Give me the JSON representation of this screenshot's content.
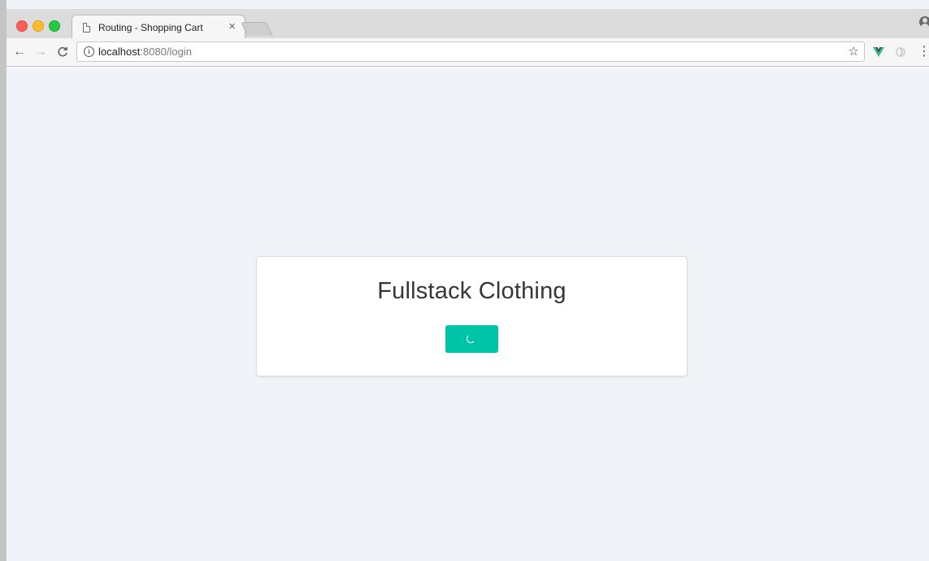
{
  "browser": {
    "tab": {
      "title": "Routing - Shopping Cart",
      "close_glyph": "×"
    },
    "address_bar": {
      "host": "localhost",
      "path": ":8080/login"
    },
    "icons": {
      "page": "page-icon",
      "info": "info-icon",
      "star": "star-icon",
      "vue_devtools": "vue-devtools-icon",
      "extension": "extension-icon",
      "menu": "kebab-menu-icon",
      "profile": "profile-icon"
    },
    "nav": {
      "back": "←",
      "forward": "→",
      "reload": "C",
      "star": "☆",
      "menu": "⋮",
      "info": "i"
    }
  },
  "page": {
    "title": "Fullstack Clothing",
    "login_button": {
      "state": "loading",
      "color": "#00c4a7"
    },
    "background_color": "#f0f4f8"
  }
}
